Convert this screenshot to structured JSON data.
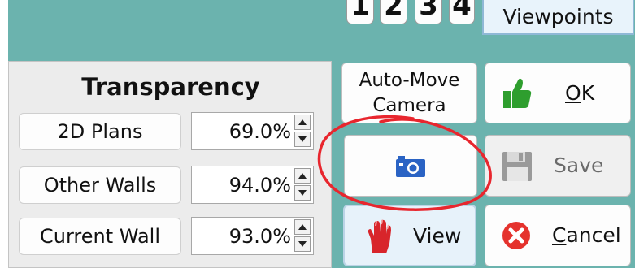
{
  "number_keys": [
    "1",
    "2",
    "3",
    "4"
  ],
  "viewpoints_label": "Viewpoints",
  "transparency": {
    "title": "Transparency",
    "rows": [
      {
        "label": "2D Plans",
        "value": "69.0%"
      },
      {
        "label": "Other Walls",
        "value": "94.0%"
      },
      {
        "label": "Current Wall",
        "value": "93.0%"
      }
    ]
  },
  "buttons": {
    "auto_move_line1": "Auto-Move",
    "auto_move_line2": "Camera",
    "camera_icon": "camera-icon",
    "view_label": "View",
    "ok_label": "OK",
    "save_label": "Save",
    "cancel_label": "Cancel"
  },
  "colors": {
    "background": "#6bb3ae",
    "annotation_circle": "#e8262e",
    "ok_icon": "#2e9e2e",
    "camera_icon": "#2a63c4",
    "cancel_icon": "#e5322d",
    "save_icon": "#9a9a9a",
    "hand_icon": "#d8252b"
  }
}
